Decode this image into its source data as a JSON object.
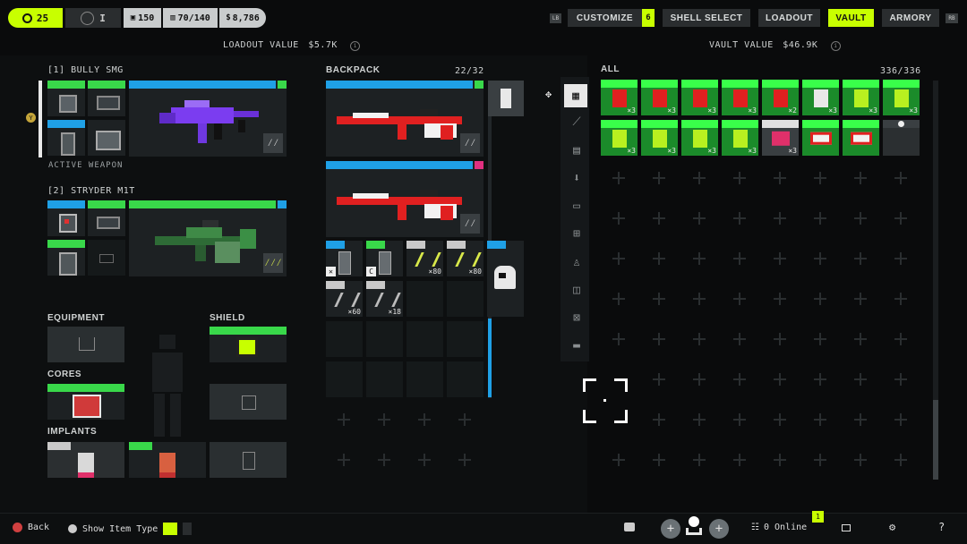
{
  "topbar": {
    "level": "25",
    "rank": "I",
    "stat_a": "150",
    "capacity": "70/140",
    "credits": "8,786",
    "lb": "LB",
    "rb": "RB",
    "nav": [
      "CUSTOMIZE",
      "SHELL SELECT",
      "LOADOUT",
      "VAULT",
      "ARMORY"
    ],
    "customize_badge": "6",
    "active_tab": "VAULT"
  },
  "loadout": {
    "value_label": "LOADOUT VALUE",
    "value": "$5.7K",
    "weapon1_name": "[1] BULLY SMG",
    "weapon1_status": "ACTIVE WEAPON",
    "weapon2_name": "[2] STRYDER M1T",
    "y_button": "Y",
    "equipment_label": "EQUIPMENT",
    "shield_label": "SHIELD",
    "cores_label": "CORES",
    "implants_label": "IMPLANTS"
  },
  "backpack": {
    "label": "BACKPACK",
    "count": "22/32",
    "qty_a": "×80",
    "qty_b": "×80",
    "qty_c": "×60",
    "qty_d": "×18"
  },
  "vault": {
    "value_label": "VAULT VALUE",
    "value": "$46.9K",
    "filter_label": "ALL",
    "count": "336/336",
    "qty_labels": [
      "×3",
      "×3",
      "×3",
      "×3",
      "×2",
      "×3",
      "×3",
      "×3",
      "×3",
      "×3",
      "×3",
      "×3",
      "×3"
    ]
  },
  "bottombar": {
    "back": "Back",
    "show_item_type": "Show Item Type",
    "online": "0 Online",
    "online_badge": "1"
  },
  "colors": {
    "accent": "#c8ff00",
    "rarity_blue": "#1fa0e6",
    "rarity_green": "#39d84a",
    "red_item": "#e02020"
  }
}
